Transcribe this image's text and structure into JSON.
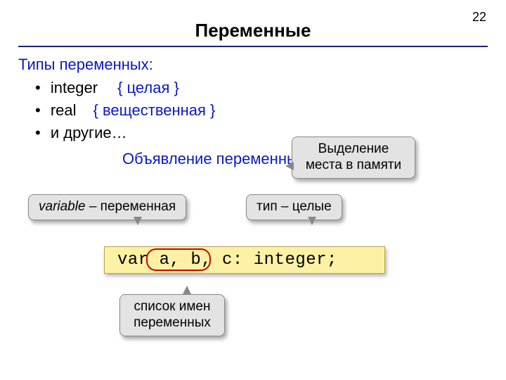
{
  "page_number": "22",
  "title": "Переменные",
  "types": {
    "heading": "Типы переменных:",
    "items": [
      {
        "name": "integer",
        "comment": "{ целая }"
      },
      {
        "name": "real",
        "comment": "{ вещественная }"
      },
      {
        "name": "и другие…",
        "comment": ""
      }
    ]
  },
  "declare_heading": "Объявление переменных:",
  "callouts": {
    "memory": "Выделение места в памяти",
    "variable_em": "variable",
    "variable_rest": " – переменная",
    "type": "тип – целые",
    "names": "список имен переменных"
  },
  "code": "var a, b, c: integer;"
}
